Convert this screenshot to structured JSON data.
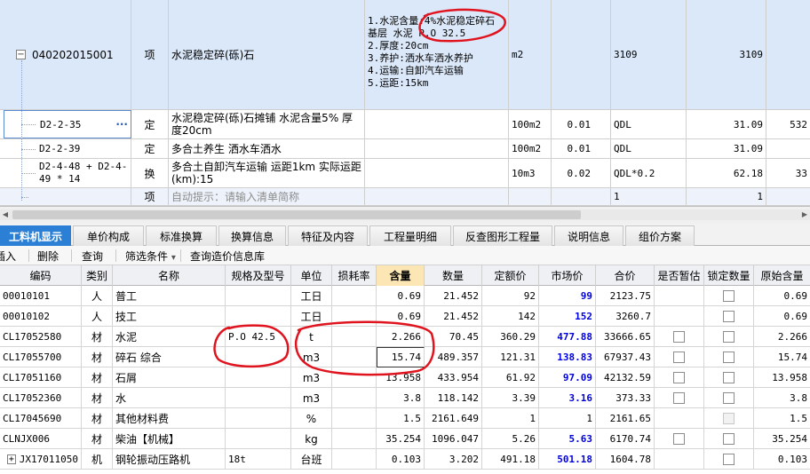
{
  "upper": {
    "main_row": {
      "code": "040202015001",
      "type": "项",
      "name": "水泥稳定碎(砾)石",
      "features": [
        "1.水泥含量:4%水泥稳定碎石",
        "基层 水泥 P.O 32.5",
        "2.厚度:20cm",
        "3.养护:洒水车洒水养护",
        "4.运输:自卸汽车运输",
        "5.运距:15km"
      ],
      "unit": "m2",
      "quantity_expr": "3109",
      "quantity": "3109"
    },
    "sub_rows": [
      {
        "code": "D2-2-35",
        "more": "···",
        "type": "定",
        "name": "水泥稳定碎(砾)石摊铺 水泥含量5% 厚度20cm",
        "unit": "100m2",
        "content": "0.01",
        "qty_expr": "QDL",
        "qty": "31.09",
        "extra": "532"
      },
      {
        "code": "D2-2-39",
        "more": "",
        "type": "定",
        "name": "多合土养生 洒水车洒水",
        "unit": "100m2",
        "content": "0.01",
        "qty_expr": "QDL",
        "qty": "31.09",
        "extra": ""
      },
      {
        "code": "D2-4-48 + D2-4-49 * 14",
        "more": "",
        "type": "换",
        "name": "多合土自卸汽车运输 运距1km 实际运距(km):15",
        "unit": "10m3",
        "content": "0.02",
        "qty_expr": "QDL*0.2",
        "qty": "62.18",
        "extra": "33"
      }
    ],
    "hint_row": {
      "type": "项",
      "placeholder": "自动提示：请输入清单简称",
      "a": "1",
      "b": "1"
    }
  },
  "tabs": [
    "工料机显示",
    "单价构成",
    "标准换算",
    "换算信息",
    "特征及内容",
    "工程量明细",
    "反查图形工程量",
    "说明信息",
    "组价方案"
  ],
  "toolbar": {
    "insert": "插入",
    "delete": "删除",
    "query": "查询",
    "filter": "筛选条件",
    "filter_arrow": "▾",
    "query_price_db": "查询造价信息库"
  },
  "lower": {
    "headers": [
      "编码",
      "类别",
      "名称",
      "规格及型号",
      "单位",
      "损耗率",
      "含量",
      "数量",
      "定额价",
      "市场价",
      "合价",
      "是否暂估",
      "锁定数量",
      "原始含量"
    ],
    "rows": [
      {
        "code": "00010101",
        "cat": "人",
        "name": "普工",
        "spec": "",
        "unit": "工日",
        "loss": "",
        "content": "0.69",
        "qty": "21.452",
        "base": "92",
        "market": "99",
        "total": "2123.75",
        "est": false,
        "lock": true,
        "orig": "0.69"
      },
      {
        "code": "00010102",
        "cat": "人",
        "name": "技工",
        "spec": "",
        "unit": "工日",
        "loss": "",
        "content": "0.69",
        "qty": "21.452",
        "base": "142",
        "market": "152",
        "total": "3260.7",
        "est": false,
        "lock": true,
        "orig": "0.69"
      },
      {
        "code": "CL17052580",
        "cat": "材",
        "name": "水泥",
        "spec": "P.O 42.5",
        "unit": "t",
        "loss": "",
        "content": "2.266",
        "qty": "70.45",
        "base": "360.29",
        "market": "477.88",
        "total": "33666.65",
        "est": true,
        "lock": true,
        "orig": "2.266"
      },
      {
        "code": "CL17055700",
        "cat": "材",
        "name": "碎石 综合",
        "spec": "",
        "unit": "m3",
        "loss": "",
        "content": "15.74",
        "qty": "489.357",
        "base": "121.31",
        "market": "138.83",
        "total": "67937.43",
        "est": true,
        "lock": true,
        "orig": "15.74"
      },
      {
        "code": "CL17051160",
        "cat": "材",
        "name": "石屑",
        "spec": "",
        "unit": "m3",
        "loss": "",
        "content": "13.958",
        "qty": "433.954",
        "base": "61.92",
        "market": "97.09",
        "total": "42132.59",
        "est": true,
        "lock": true,
        "orig": "13.958"
      },
      {
        "code": "CL17052360",
        "cat": "材",
        "name": "水",
        "spec": "",
        "unit": "m3",
        "loss": "",
        "content": "3.8",
        "qty": "118.142",
        "base": "3.39",
        "market": "3.16",
        "total": "373.33",
        "est": true,
        "lock": true,
        "orig": "3.8"
      },
      {
        "code": "CL17045690",
        "cat": "材",
        "name": "其他材料费",
        "spec": "",
        "unit": "%",
        "loss": "",
        "content": "1.5",
        "qty": "2161.649",
        "base": "1",
        "market": "1",
        "total": "2161.65",
        "est": false,
        "lock": "disabled",
        "orig": "1.5"
      },
      {
        "code": "CLNJX006",
        "cat": "材",
        "name": "柴油【机械】",
        "spec": "",
        "unit": "kg",
        "loss": "",
        "content": "35.254",
        "qty": "1096.047",
        "base": "5.26",
        "market": "5.63",
        "total": "6170.74",
        "est": true,
        "lock": true,
        "orig": "35.254"
      },
      {
        "code": "JX17011050",
        "cat": "机",
        "name": "钢轮振动压路机",
        "spec": "18t",
        "unit": "台班",
        "loss": "",
        "content": "0.103",
        "qty": "3.202",
        "base": "491.18",
        "market": "501.18",
        "total": "1604.78",
        "est": false,
        "lock": true,
        "orig": "0.103"
      }
    ],
    "market_bold_rows": [
      0,
      1,
      2,
      3,
      4,
      5,
      7,
      8
    ]
  },
  "colors": {
    "accent": "#2b7fd4",
    "annotation": "#e0141e",
    "market_price": "#0000e0",
    "selected_row": "#dbe8f9",
    "content_header": "#fce6b4"
  }
}
